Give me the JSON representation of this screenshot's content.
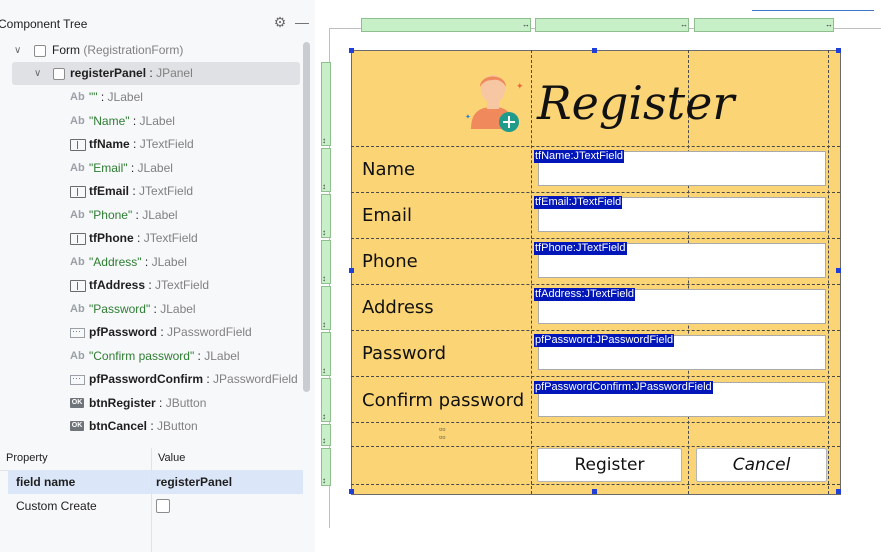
{
  "component_tree": {
    "title": "Component Tree",
    "gear_icon": "gear-icon",
    "minimize_icon": "minimize-icon",
    "form": {
      "name": "Form",
      "type": "(RegistrationForm)"
    },
    "panel": {
      "name": "registerPanel",
      "type": "JPanel"
    },
    "items": [
      {
        "icon": "Ab",
        "name": "\"\"",
        "type": "JLabel",
        "kind": "label"
      },
      {
        "icon": "Ab",
        "name": "\"Name\"",
        "type": "JLabel",
        "kind": "label"
      },
      {
        "icon": "textfield-icon",
        "name": "tfName",
        "type": "JTextField",
        "kind": "field"
      },
      {
        "icon": "Ab",
        "name": "\"Email\"",
        "type": "JLabel",
        "kind": "label"
      },
      {
        "icon": "textfield-icon",
        "name": "tfEmail",
        "type": "JTextField",
        "kind": "field"
      },
      {
        "icon": "Ab",
        "name": "\"Phone\"",
        "type": "JLabel",
        "kind": "label"
      },
      {
        "icon": "textfield-icon",
        "name": "tfPhone",
        "type": "JTextField",
        "kind": "field"
      },
      {
        "icon": "Ab",
        "name": "\"Address\"",
        "type": "JLabel",
        "kind": "label"
      },
      {
        "icon": "textfield-icon",
        "name": "tfAddress",
        "type": "JTextField",
        "kind": "field"
      },
      {
        "icon": "Ab",
        "name": "\"Password\"",
        "type": "JLabel",
        "kind": "label"
      },
      {
        "icon": "passwordfield-icon",
        "name": "pfPassword",
        "type": "JPasswordField",
        "kind": "field"
      },
      {
        "icon": "Ab",
        "name": "\"Confirm password\"",
        "type": "JLabel",
        "kind": "label"
      },
      {
        "icon": "passwordfield-icon",
        "name": "pfPasswordConfirm",
        "type": "JPasswordField",
        "kind": "field"
      },
      {
        "icon": "OK",
        "name": "btnRegister",
        "type": "JButton",
        "kind": "button"
      },
      {
        "icon": "OK",
        "name": "btnCancel",
        "type": "JButton",
        "kind": "button"
      }
    ]
  },
  "properties": {
    "col_property": "Property",
    "col_value": "Value",
    "rows": [
      {
        "name": "field name",
        "value": "registerPanel"
      },
      {
        "name": "Custom Create",
        "value": ""
      }
    ]
  },
  "form_preview": {
    "title": "Register",
    "labels": [
      "Name",
      "Email",
      "Phone",
      "Address",
      "Password",
      "Confirm password"
    ],
    "field_tags": [
      "tfName:JTextField",
      "tfEmail:JTextField",
      "tfPhone:JTextField",
      "tfAddress:JTextField",
      "pfPassword:JPasswordField",
      "pfPasswordConfirm:JPasswordField"
    ],
    "register_button": "Register",
    "cancel_button": "Cancel",
    "colors": {
      "panel_bg": "#fbd475",
      "selection": "#0016b8",
      "grid_header": "#c8f0c8"
    },
    "grid_header_glyph": "↔",
    "row_header_glyph": "↕"
  }
}
